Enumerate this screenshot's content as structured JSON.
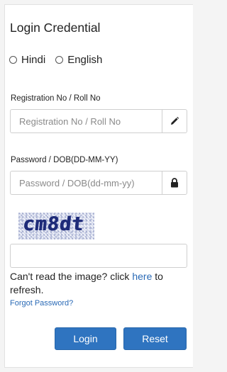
{
  "form": {
    "title": "Login Credential",
    "languages": [
      {
        "label": "Hindi",
        "selected": false
      },
      {
        "label": "English",
        "selected": false
      }
    ],
    "registration": {
      "label": "Registration No / Roll No",
      "placeholder": "Registration No / Roll No",
      "icon": "pencil-icon"
    },
    "password": {
      "label": "Password / DOB(DD-MM-YY)",
      "placeholder": "Password / DOB(dd-mm-yy)",
      "icon": "lock-icon"
    },
    "captcha": {
      "image_text": "cm8dt",
      "input_value": ""
    },
    "help": {
      "prefix": "Can't read the image? click ",
      "link": "here",
      "suffix": " to refresh."
    },
    "forgot_password": "Forgot Password?",
    "buttons": {
      "login": "Login",
      "reset": "Reset"
    }
  },
  "colors": {
    "primary_button": "#2f74c0",
    "link": "#2a6ab6"
  }
}
